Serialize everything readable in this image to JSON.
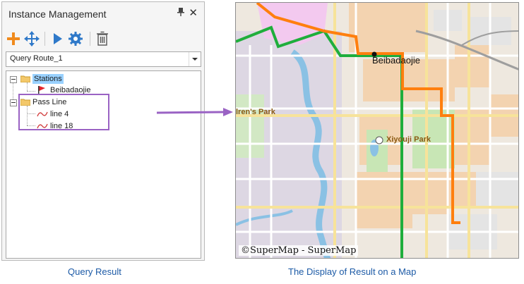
{
  "panel": {
    "title": "Instance Management",
    "pin_glyph": "📌",
    "close_glyph": "✕",
    "toolbar": [
      {
        "name": "add-icon"
      },
      {
        "name": "move-icon"
      },
      {
        "name": "run-icon"
      },
      {
        "name": "settings-icon"
      },
      {
        "name": "delete-icon"
      }
    ],
    "dropdown_value": "Query Route_1",
    "tree": {
      "stations_label": "Stations",
      "station_item": "Beibadaojie",
      "passline_label": "Pass Line",
      "lines": [
        "line 4",
        "line 18"
      ]
    }
  },
  "map": {
    "labels": {
      "beibadaojie": "Beibadaojie",
      "park_left": "lren's Park",
      "park_right": "Xiyouji Park"
    },
    "copyright": "©SuperMap - SuperMap",
    "colors": {
      "route_orange": "#ff7f0e",
      "route_green": "#1fae3c",
      "water": "#8ac1e4"
    }
  },
  "captions": {
    "left": "Query Result",
    "right": "The Display of Result on a Map"
  }
}
